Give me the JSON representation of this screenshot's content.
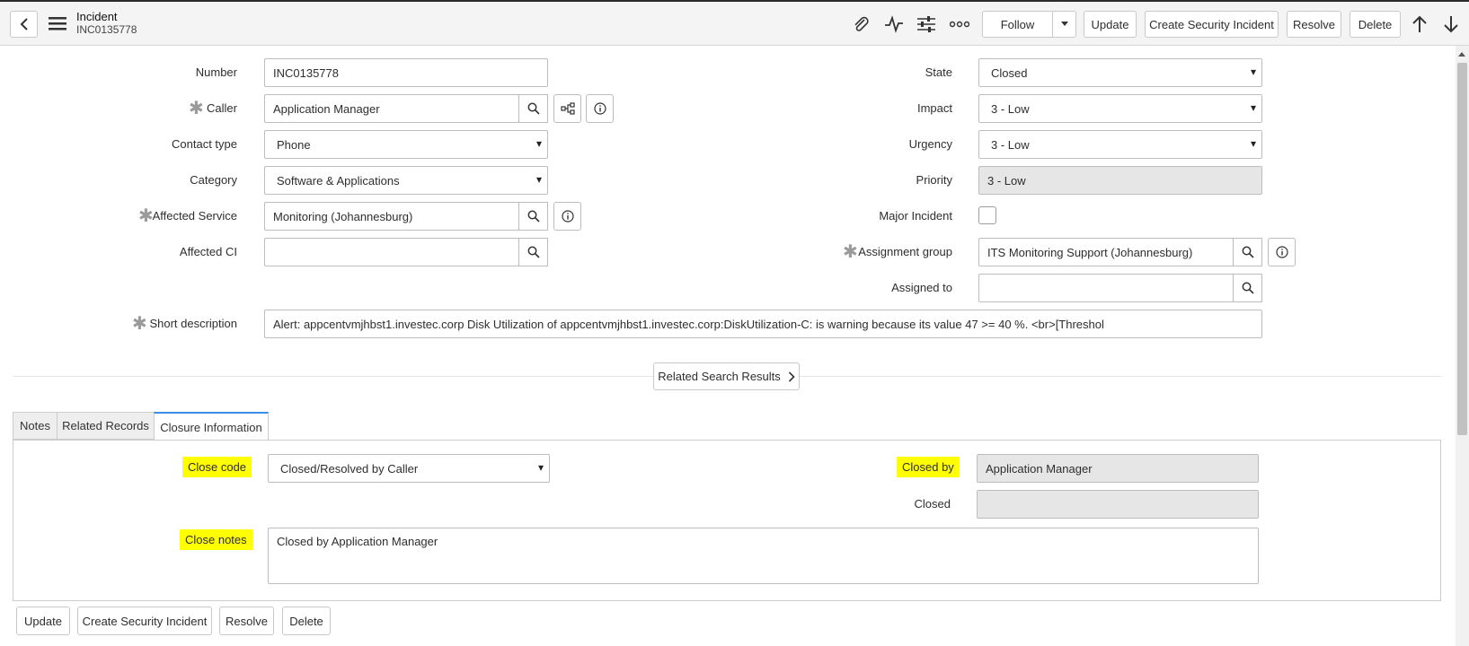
{
  "header": {
    "title": "Incident",
    "number": "INC0135778",
    "buttons": {
      "follow": "Follow",
      "update": "Update",
      "create_security_incident": "Create Security Incident",
      "resolve": "Resolve",
      "delete": "Delete"
    },
    "icons": [
      "back-icon",
      "menu-icon",
      "attachment-icon",
      "activity-icon",
      "settings-sliders-icon",
      "more-icon",
      "caret-down-icon",
      "arrow-up-icon",
      "arrow-down-icon"
    ]
  },
  "form": {
    "number": {
      "label": "Number",
      "value": "INC0135778"
    },
    "caller": {
      "label": "Caller",
      "value": "Application Manager"
    },
    "contact_type": {
      "label": "Contact type",
      "value": "Phone"
    },
    "category": {
      "label": "Category",
      "value": "Software & Applications"
    },
    "affected_service": {
      "label": "Affected Service",
      "value": "Monitoring (Johannesburg)"
    },
    "affected_ci": {
      "label": "Affected CI",
      "value": ""
    },
    "state": {
      "label": "State",
      "value": "Closed"
    },
    "impact": {
      "label": "Impact",
      "value": "3 - Low"
    },
    "urgency": {
      "label": "Urgency",
      "value": "3 - Low"
    },
    "priority": {
      "label": "Priority",
      "value": "3 - Low"
    },
    "major_incident": {
      "label": "Major Incident",
      "checked": false
    },
    "assignment_group": {
      "label": "Assignment group",
      "value": "ITS Monitoring Support (Johannesburg)"
    },
    "assigned_to": {
      "label": "Assigned to",
      "value": ""
    },
    "short_description": {
      "label": "Short description",
      "value": "Alert: appcentvmjhbst1.investec.corp Disk Utilization of appcentvmjhbst1.investec.corp:DiskUtilization-C: is warning because its value 47 >= 40 %. <br>[Threshol"
    }
  },
  "related_search": {
    "label": "Related Search Results"
  },
  "tabs": [
    {
      "label": "Notes"
    },
    {
      "label": "Related Records"
    },
    {
      "label": "Closure Information"
    }
  ],
  "closure": {
    "close_code": {
      "label": "Close code",
      "value": "Closed/Resolved by Caller"
    },
    "closed_by": {
      "label": "Closed by",
      "value": "Application Manager"
    },
    "closed": {
      "label": "Closed",
      "value": ""
    },
    "close_notes": {
      "label": "Close notes",
      "value": "Closed by Application Manager"
    },
    "highlight_color": "#ffff00"
  },
  "bottom_buttons": {
    "update": "Update",
    "create_security_incident": "Create Security Incident",
    "resolve": "Resolve",
    "delete": "Delete"
  },
  "colors": {
    "header_bg": "#f4f4f5",
    "active_tab": "#3a8ee6",
    "readonly_bg": "#e6e6e6"
  }
}
